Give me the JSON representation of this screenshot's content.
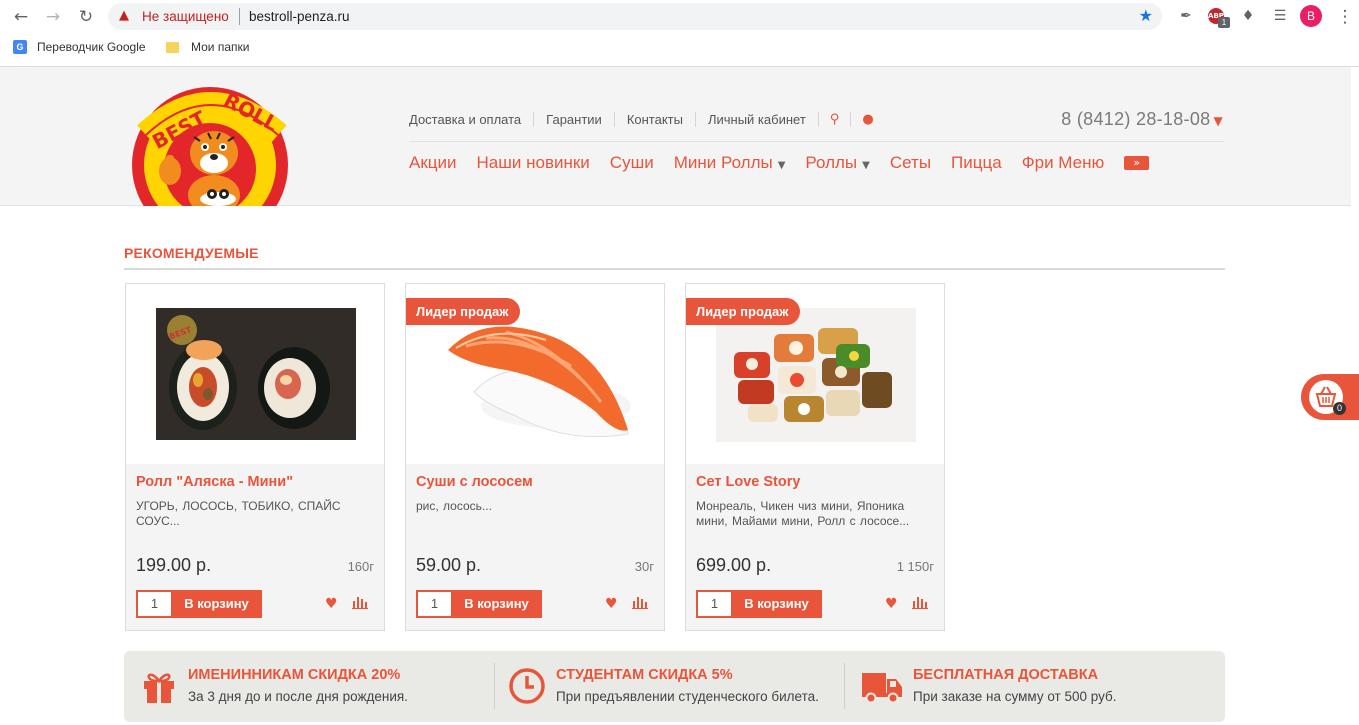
{
  "browser": {
    "insecure_label": "Не защищено",
    "url": "bestroll-penza.ru",
    "profile_initial": "B",
    "abp_label": "ABP",
    "abp_count": "1",
    "bookmarks": [
      {
        "label": "Переводчик Google",
        "icon": "google-translate-icon"
      },
      {
        "label": "Мои папки",
        "icon": "folder-icon"
      }
    ]
  },
  "header": {
    "top_links": [
      "Доставка и оплата",
      "Гарантии",
      "Контакты",
      "Личный кабинет"
    ],
    "phone": "8 (8412) 28-18-08",
    "menu": [
      {
        "label": "Акции"
      },
      {
        "label": "Наши новинки"
      },
      {
        "label": "Суши"
      },
      {
        "label": "Мини Роллы",
        "dropdown": true
      },
      {
        "label": "Роллы",
        "dropdown": true
      },
      {
        "label": "Сеты"
      },
      {
        "label": "Пицца"
      },
      {
        "label": "Фри Меню"
      }
    ]
  },
  "section": {
    "title": "РЕКОМЕНДУЕМЫЕ"
  },
  "products": [
    {
      "name": "Ролл \"Аляска - Мини\"",
      "desc": "УГОРЬ, ЛОСОСЬ, ТОБИКО, СПАЙС СОУС...",
      "price": "199.00 р.",
      "weight": "160г",
      "qty": "1",
      "cart_label": "В корзину",
      "badge": ""
    },
    {
      "name": "Суши с лососем",
      "desc": "рис, лосось...",
      "price": "59.00 р.",
      "weight": "30г",
      "qty": "1",
      "cart_label": "В корзину",
      "badge": "Лидер продаж"
    },
    {
      "name": "Сет Love Story",
      "desc": "Монреаль,  Чикен чиз мини,  Японика мини,  Майами мини,  Ролл с лососе...",
      "price": "699.00 р.",
      "weight": "1 150г",
      "qty": "1",
      "cart_label": "В корзину",
      "badge": "Лидер продаж"
    }
  ],
  "cart": {
    "count": "0"
  },
  "promos": [
    {
      "title": "ИМЕНИННИКАМ СКИДКА 20%",
      "sub": "За 3 дня до и после дня рождения.",
      "icon": "gift-icon"
    },
    {
      "title": "СТУДЕНТАМ СКИДКА 5%",
      "sub": "При предъявлении студенческого билета.",
      "icon": "clock-icon"
    },
    {
      "title": "БЕСПЛАТНАЯ ДОСТАВКА",
      "sub": "При заказе на сумму от 500 руб.",
      "icon": "truck-icon"
    }
  ],
  "colors": {
    "accent": "#e8553a",
    "header_bg": "#f4f4f4",
    "promo_bg": "#e9e9e6"
  }
}
